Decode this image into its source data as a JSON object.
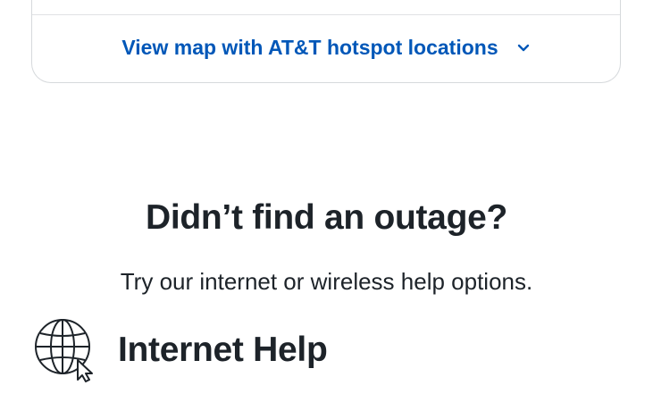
{
  "map_card": {
    "link_label": "View map with AT&T hotspot locations",
    "chevron_icon": "chevron-down-icon"
  },
  "outage": {
    "heading": "Didn’t find an outage?",
    "subtext": "Try our internet or wireless help options."
  },
  "internet_help": {
    "title": "Internet Help",
    "icon": "globe-cursor-icon"
  },
  "colors": {
    "link": "#0057b8",
    "text": "#1d2329",
    "border": "#d6d9dc"
  }
}
